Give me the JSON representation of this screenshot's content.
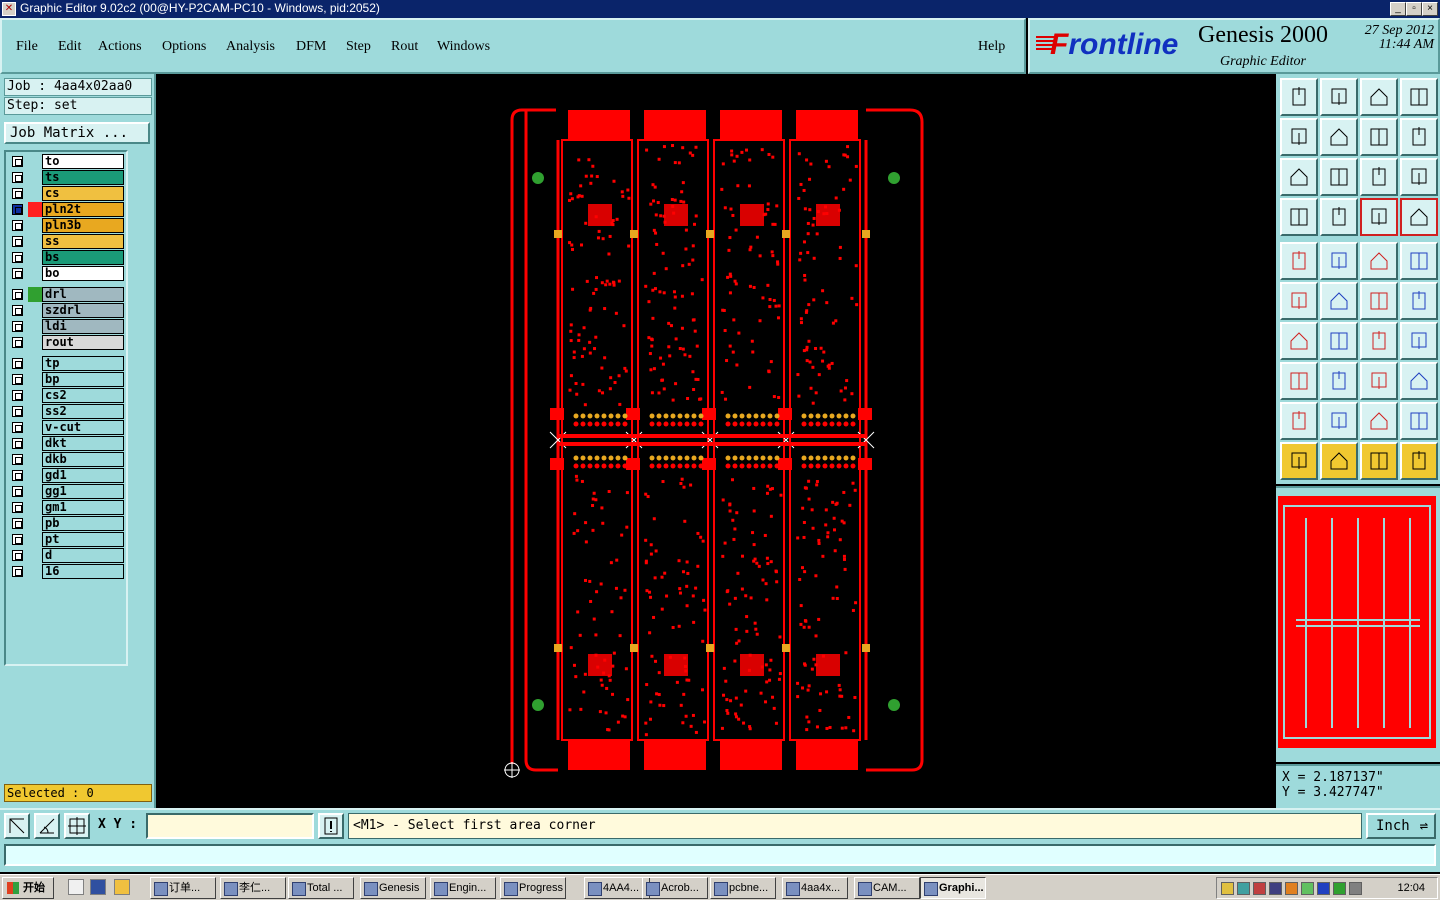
{
  "window": {
    "title": "Graphic Editor 9.02c2 (00@HY-P2CAM-PC10 - Windows, pid:2052)",
    "controls": [
      "_",
      "▫",
      "×"
    ]
  },
  "menu": {
    "items": [
      "File",
      "Edit",
      "Actions",
      "Options",
      "Analysis",
      "DFM",
      "Step",
      "Rout",
      "Windows"
    ],
    "help": "Help"
  },
  "brand": {
    "logo_f": "F",
    "logo_rest": "rontline",
    "product": "Genesis 2000",
    "subtitle": "Graphic Editor",
    "date_line1": "27 Sep 2012",
    "date_line2": "11:44 AM"
  },
  "job": {
    "job_line": "Job : 4aa4x02aa0",
    "step_line": "Step: set",
    "matrix_button": "Job Matrix ..."
  },
  "layers": [
    {
      "name": "to",
      "color": "#ffffff",
      "swatch": ""
    },
    {
      "name": "ts",
      "color": "#1a9a78",
      "swatch": ""
    },
    {
      "name": "cs",
      "color": "#f0c040",
      "swatch": ""
    },
    {
      "name": "pln2t",
      "color": "#e8a820",
      "swatch": "#ff2020",
      "active": true
    },
    {
      "name": "pln3b",
      "color": "#e8a820",
      "swatch": ""
    },
    {
      "name": "ss",
      "color": "#f0c040",
      "swatch": ""
    },
    {
      "name": "bs",
      "color": "#1a9a78",
      "swatch": ""
    },
    {
      "name": "bo",
      "color": "#ffffff",
      "swatch": ""
    },
    {
      "name": "drl",
      "color": "#a0b8c0",
      "swatch": "#30a030"
    },
    {
      "name": "szdrl",
      "color": "#a0b8c0",
      "swatch": ""
    },
    {
      "name": "ldi",
      "color": "#a0b8c0",
      "swatch": ""
    },
    {
      "name": "rout",
      "color": "#d8d8d8",
      "swatch": ""
    },
    {
      "name": "tp",
      "color": "#9edadb",
      "swatch": ""
    },
    {
      "name": "bp",
      "color": "#9edadb",
      "swatch": ""
    },
    {
      "name": "cs2",
      "color": "#9edadb",
      "swatch": ""
    },
    {
      "name": "ss2",
      "color": "#9edadb",
      "swatch": ""
    },
    {
      "name": "v-cut",
      "color": "#9edadb",
      "swatch": ""
    },
    {
      "name": "dkt",
      "color": "#9edadb",
      "swatch": ""
    },
    {
      "name": "dkb",
      "color": "#9edadb",
      "swatch": ""
    },
    {
      "name": "gd1",
      "color": "#9edadb",
      "swatch": ""
    },
    {
      "name": "gg1",
      "color": "#9edadb",
      "swatch": ""
    },
    {
      "name": "gm1",
      "color": "#9edadb",
      "swatch": ""
    },
    {
      "name": "pb",
      "color": "#9edadb",
      "swatch": ""
    },
    {
      "name": "pt",
      "color": "#9edadb",
      "swatch": ""
    },
    {
      "name": "d",
      "color": "#9edadb",
      "swatch": ""
    },
    {
      "name": "16",
      "color": "#9edadb",
      "swatch": ""
    }
  ],
  "selected": "Selected : 0",
  "coords": {
    "x": "X = 2.187137\"",
    "y": "Y = 3.427747\""
  },
  "bottom": {
    "xy_label": "X Y :",
    "xy_value": "",
    "message": "<M1> - Select first area corner",
    "unit": "Inch"
  },
  "taskbar": {
    "start": "开始",
    "tasks": [
      "订单...",
      "李仁...",
      "Total ...",
      "Genesis",
      "Engin...",
      "Progress",
      "4AA4...",
      "Acrob...",
      "pcbne...",
      "4aa4x...",
      "CAM...",
      "Graphi..."
    ],
    "clock": "12:04"
  },
  "colors": {
    "accent": "#9edadb",
    "pcb": "#ff0000",
    "pad": "#e8a820",
    "fiducial": "#30a030"
  }
}
